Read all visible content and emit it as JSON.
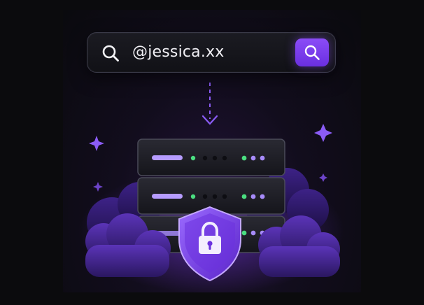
{
  "search": {
    "query": "@jessica.xx"
  },
  "icons": {
    "search_left": "search-icon",
    "search_button": "search-icon",
    "arrow": "dashed-arrow-down-icon",
    "server": "server-stack-icon",
    "shield": "shield-lock-icon",
    "sparkles": "sparkle-icon",
    "clouds": "cloud-icon"
  },
  "colors": {
    "accent": "#7c3aed",
    "accent_light": "#a78bfa",
    "indicator_green": "#4ade80",
    "indicator_purple": "#a78bfa",
    "background": "#0b0b0d"
  }
}
